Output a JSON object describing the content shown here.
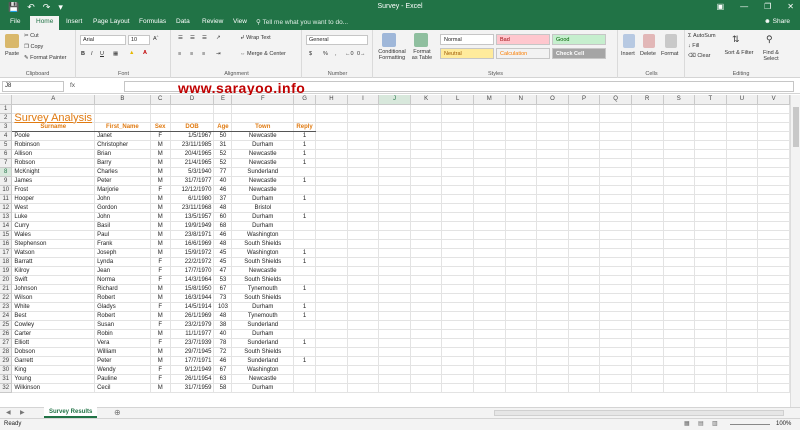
{
  "window": {
    "title": "Survey - Excel"
  },
  "tabs": [
    "File",
    "Home",
    "Insert",
    "Page Layout",
    "Formulas",
    "Data",
    "Review",
    "View"
  ],
  "active_tab": "Home",
  "tell_me": "Tell me what you want to do...",
  "share": "Share",
  "ribbon": {
    "clipboard": {
      "paste": "Paste",
      "cut": "Cut",
      "copy": "Copy",
      "format_painter": "Format Painter",
      "label": "Clipboard"
    },
    "font": {
      "name": "Arial",
      "size": "10",
      "label": "Font",
      "bold": "B",
      "italic": "I",
      "underline": "U"
    },
    "alignment": {
      "wrap": "Wrap Text",
      "merge": "Merge & Center",
      "label": "Alignment"
    },
    "number": {
      "format": "General",
      "dollar": "$",
      "percent": "%",
      "comma": ",",
      "label": "Number"
    },
    "styles": {
      "conditional": "Conditional Formatting",
      "table": "Format as Table",
      "normal": "Normal",
      "bad": "Bad",
      "good": "Good",
      "neutral": "Neutral",
      "calculation": "Calculation",
      "check": "Check Cell",
      "label": "Styles"
    },
    "cells": {
      "insert": "Insert",
      "delete": "Delete",
      "format": "Format",
      "label": "Cells"
    },
    "editing": {
      "autosum": "AutoSum",
      "fill": "Fill",
      "clear": "Clear",
      "sort": "Sort & Filter",
      "find": "Find & Select",
      "label": "Editing"
    }
  },
  "name_box": "J8",
  "fx": "fx",
  "watermark": "www.sarayoo.info",
  "columns": [
    "A",
    "B",
    "C",
    "D",
    "E",
    "F",
    "G",
    "H",
    "I",
    "J",
    "K",
    "L",
    "M",
    "N",
    "O",
    "P",
    "Q",
    "R",
    "S",
    "T",
    "U",
    "V"
  ],
  "sheet_title": "Survey Analysis",
  "headers": [
    "Surname",
    "First_Name",
    "Sex",
    "DOB",
    "Age",
    "Town",
    "Reply"
  ],
  "rows": [
    [
      "Poole",
      "Janet",
      "F",
      "1/5/1967",
      "50",
      "Newcastle",
      "1"
    ],
    [
      "Robinson",
      "Christopher",
      "M",
      "23/11/1985",
      "31",
      "Durham",
      "1"
    ],
    [
      "Allison",
      "Brian",
      "M",
      "20/4/1965",
      "52",
      "Newcastle",
      "1"
    ],
    [
      "Robson",
      "Barry",
      "M",
      "21/4/1965",
      "52",
      "Newcastle",
      "1"
    ],
    [
      "McKnight",
      "Charles",
      "M",
      "5/3/1940",
      "77",
      "Sunderland",
      ""
    ],
    [
      "James",
      "Peter",
      "M",
      "31/7/1977",
      "40",
      "Newcastle",
      "1"
    ],
    [
      "Frost",
      "Marjorie",
      "F",
      "12/12/1970",
      "46",
      "Newcastle",
      ""
    ],
    [
      "Hooper",
      "John",
      "M",
      "6/1/1980",
      "37",
      "Durham",
      "1"
    ],
    [
      "West",
      "Gordon",
      "M",
      "23/11/1968",
      "48",
      "Bristol",
      ""
    ],
    [
      "Luke",
      "John",
      "M",
      "13/5/1957",
      "60",
      "Durham",
      "1"
    ],
    [
      "Curry",
      "Basil",
      "M",
      "19/9/1949",
      "68",
      "Durham",
      ""
    ],
    [
      "Wales",
      "Paul",
      "M",
      "23/8/1971",
      "46",
      "Washington",
      ""
    ],
    [
      "Stephenson",
      "Frank",
      "M",
      "16/6/1969",
      "48",
      "South Shields",
      ""
    ],
    [
      "Watson",
      "Joseph",
      "M",
      "15/9/1972",
      "45",
      "Washington",
      "1"
    ],
    [
      "Barratt",
      "Lynda",
      "F",
      "22/2/1972",
      "45",
      "South Shields",
      "1"
    ],
    [
      "Kilroy",
      "Jean",
      "F",
      "17/7/1970",
      "47",
      "Newcastle",
      ""
    ],
    [
      "Swift",
      "Norma",
      "F",
      "14/3/1964",
      "53",
      "South Shields",
      ""
    ],
    [
      "Johnson",
      "Richard",
      "M",
      "15/8/1950",
      "67",
      "Tynemouth",
      "1"
    ],
    [
      "Wilson",
      "Robert",
      "M",
      "16/3/1944",
      "73",
      "South Shields",
      ""
    ],
    [
      "White",
      "Gladys",
      "F",
      "14/5/1914",
      "103",
      "Durham",
      "1"
    ],
    [
      "Best",
      "Robert",
      "M",
      "26/1/1969",
      "48",
      "Tynemouth",
      "1"
    ],
    [
      "Cowley",
      "Susan",
      "F",
      "23/2/1979",
      "38",
      "Sunderland",
      ""
    ],
    [
      "Carter",
      "Robin",
      "M",
      "11/1/1977",
      "40",
      "Durham",
      ""
    ],
    [
      "Elliott",
      "Vera",
      "F",
      "23/7/1939",
      "78",
      "Sunderland",
      "1"
    ],
    [
      "Dobson",
      "William",
      "M",
      "29/7/1945",
      "72",
      "South Shields",
      ""
    ],
    [
      "Garrett",
      "Peter",
      "M",
      "17/7/1971",
      "46",
      "Sunderland",
      "1"
    ],
    [
      "King",
      "Wendy",
      "F",
      "9/12/1949",
      "67",
      "Washington",
      ""
    ],
    [
      "Young",
      "Pauline",
      "F",
      "26/1/1954",
      "63",
      "Newcastle",
      ""
    ],
    [
      "Wilkinson",
      "Cecil",
      "M",
      "31/7/1959",
      "58",
      "Durham",
      ""
    ]
  ],
  "sheet_tab": "Survey Results",
  "status": {
    "ready": "Ready",
    "zoom": "100%"
  }
}
